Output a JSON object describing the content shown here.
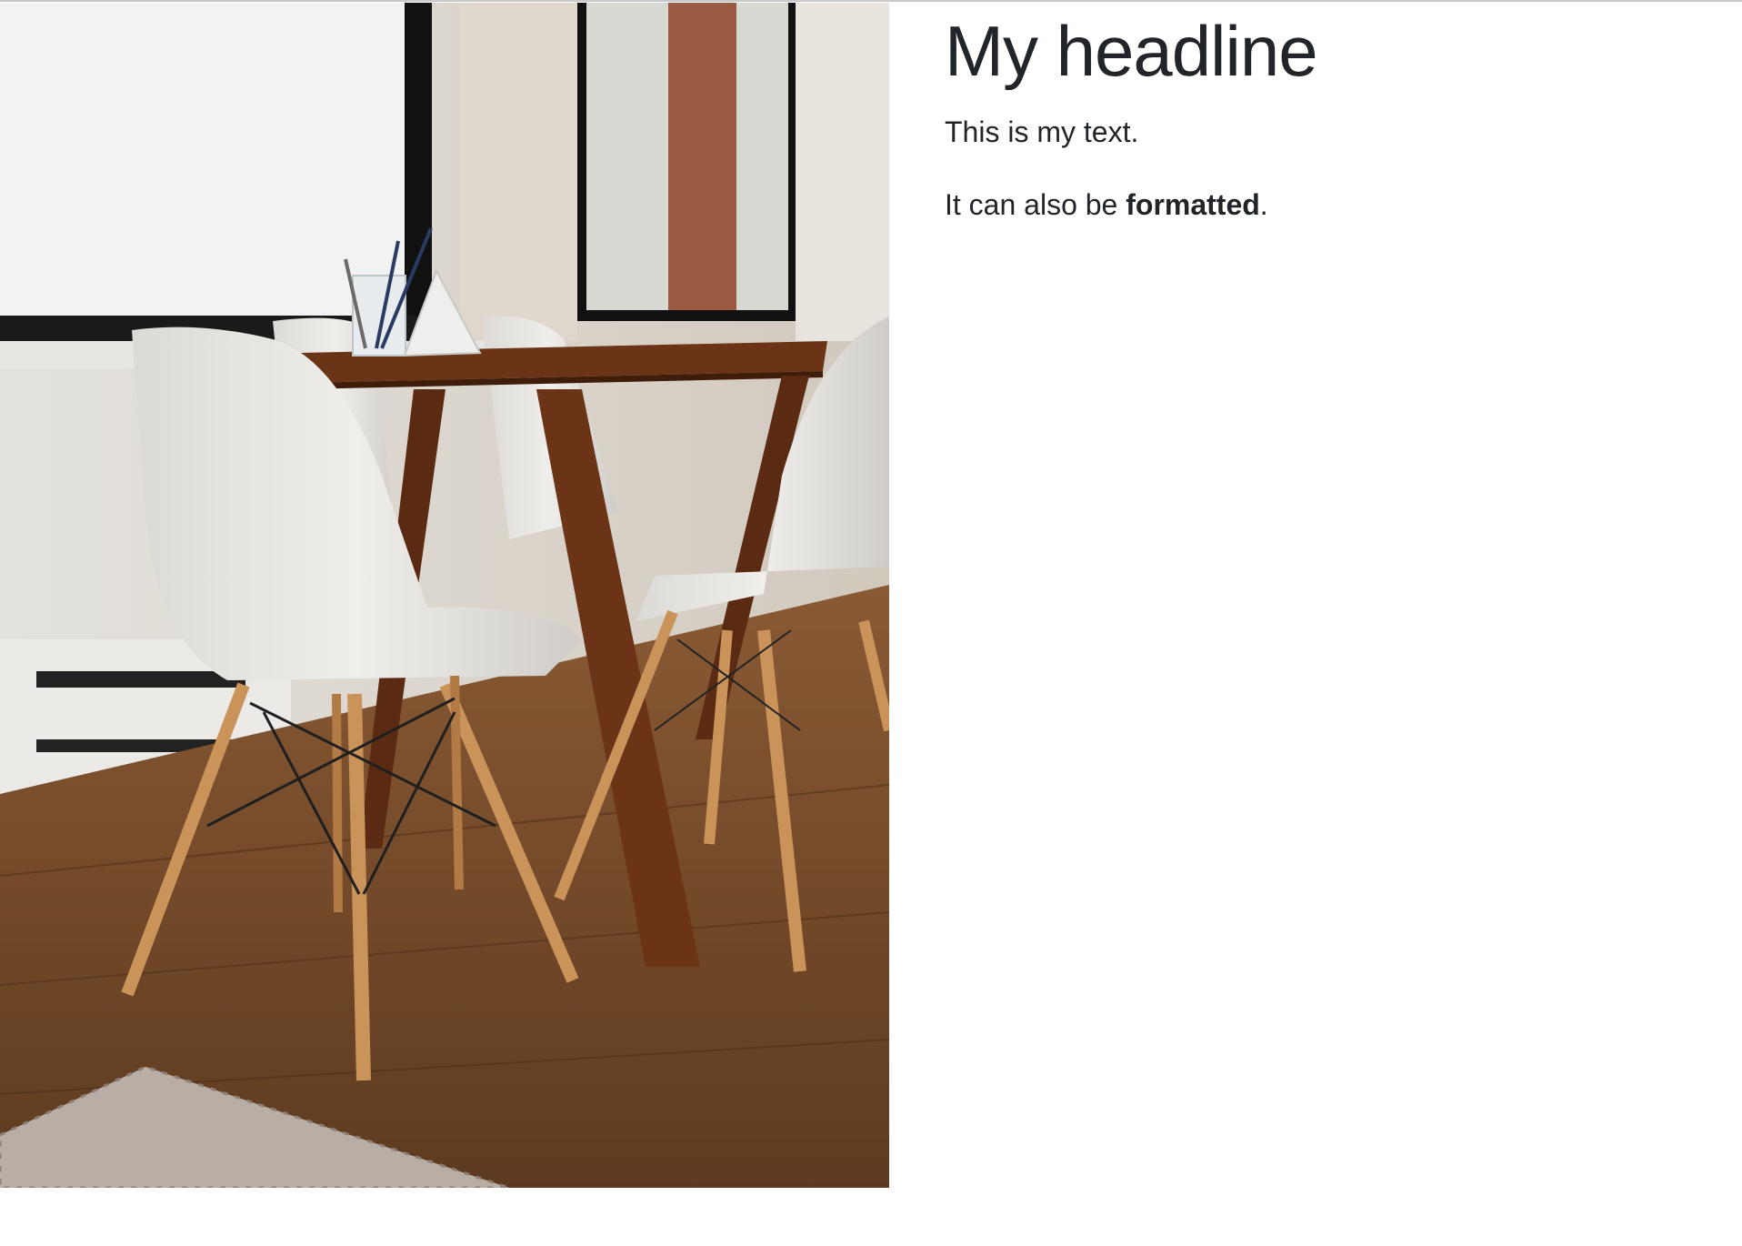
{
  "page": {
    "headline": "My headline",
    "paragraph_1": "This is my text.",
    "paragraph_2": {
      "prefix": "It can also be ",
      "emphasis": "formatted",
      "suffix": "."
    }
  },
  "image": {
    "subject": "dining table with white chairs by a window"
  },
  "colors": {
    "text": "#212529",
    "background": "#ffffff",
    "wood_floor": "#7a4a26",
    "table_wood": "#6b3416",
    "chair_shell": "#e9e7e4"
  }
}
